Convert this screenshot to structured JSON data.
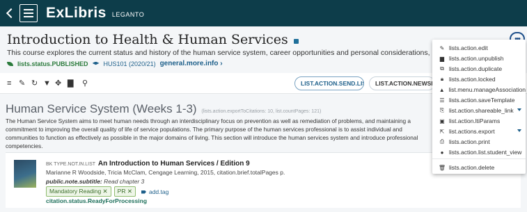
{
  "brand": {
    "logo": "ExLibris",
    "product": "LEGANTO"
  },
  "header": {
    "title": "Introduction to Health & Human Services",
    "description": "This course explores the current status and history of the human service system, career opportunities and personal considerations, as well as an in",
    "status": "lists.status.PUBLISHED",
    "course": "HUS101 (2020/21)",
    "more_info": "general.more.info ›",
    "more_button": "•••"
  },
  "toolbar": {
    "icons": [
      "list-icon",
      "edit-icon",
      "refresh-icon",
      "filter-icon",
      "collapse-icon",
      "analytics-icon",
      "search-icon"
    ],
    "send_list": "LIST.ACTION.SEND.LIST",
    "new_section": "LIST.ACTION.NEWSECTIO"
  },
  "section": {
    "title": "Human Service System (Weeks 1-3)",
    "meta": "(lists.action.exportToCitations: 10, list.countPages: 121)",
    "description": "The Human Service System aims to meet human needs through an interdisciplinary focus on prevention as well as remediation of problems, and maintaining a commitment to improving the overall quality of life of service populations. The primary purpose of the human services professional is to assist individual and communities to function as effectively as possible in the major domains of living. This section will introduce the human services system and introduce professional competencies."
  },
  "citation": {
    "type": "BK TYPE.NOT.IN.LIST",
    "title": "An Introduction to Human Services / Edition 9",
    "authors": "Marianne R Woodside, Tricia McClam, Cengage Learning, 2015, citation.brief.totalPages p.",
    "note_label": "public.note.subtitle:",
    "note_value": "Read chapter 3",
    "tags": [
      "Mandatory Reading ✕",
      "PR ✕"
    ],
    "add_tag": "add.tag",
    "status": "citation.status.ReadyForProcessing"
  },
  "menu": {
    "items": [
      {
        "label": "lists.action.edit",
        "icon": "✎"
      },
      {
        "label": "lists.action.unpublish",
        "icon": "▆"
      },
      {
        "label": "lists.action.duplicate",
        "icon": "⧉"
      },
      {
        "label": "lists.action.locked",
        "icon": "🔒︎"
      },
      {
        "label": "list.menu.manageAssociation",
        "icon": "▲"
      },
      {
        "label": "lists.action.saveTemplate",
        "icon": "☰"
      },
      {
        "label": "list.action.shareable_link",
        "icon": "⎘"
      },
      {
        "label": "list.action.ltiParams",
        "icon": "▣"
      },
      {
        "label": "list.actions.export",
        "icon": "⇱"
      },
      {
        "label": "lists.action.print",
        "icon": "⎙"
      },
      {
        "label": "lists.action.list.student_view",
        "icon": "●"
      },
      {
        "label": "lists.action.delete",
        "icon": "🗑︎"
      }
    ]
  }
}
